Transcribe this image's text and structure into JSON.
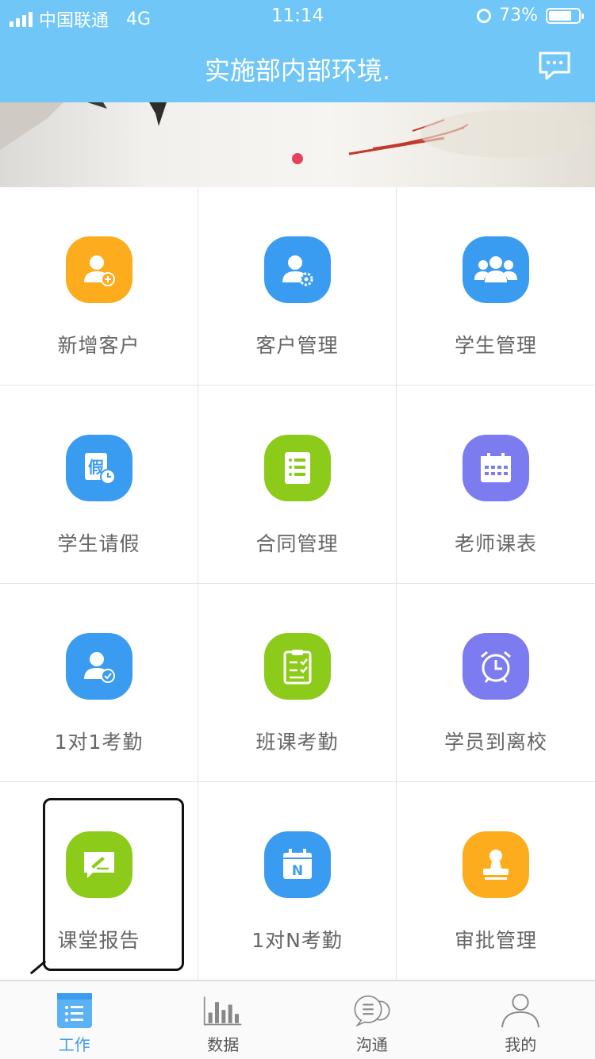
{
  "status_bar": {
    "carrier": "中国联通",
    "network": "4G",
    "time": "11:14",
    "battery": "73%"
  },
  "header": {
    "title": "实施部内部环境."
  },
  "colors": {
    "nav": "#6fc6f7",
    "orange": "#fcac1c",
    "blue": "#3a9cf0",
    "green": "#8dcb1a",
    "purple": "#7d7bf0",
    "indicator": "#e8415e"
  },
  "grid": {
    "items": [
      {
        "label": "新增客户",
        "icon": "user-add-icon"
      },
      {
        "label": "客户管理",
        "icon": "user-settings-icon"
      },
      {
        "label": "学生管理",
        "icon": "users-group-icon"
      },
      {
        "label": "学生请假",
        "icon": "leave-clock-icon"
      },
      {
        "label": "合同管理",
        "icon": "contract-list-icon"
      },
      {
        "label": "老师课表",
        "icon": "calendar-icon"
      },
      {
        "label": "1对1考勤",
        "icon": "user-check-icon"
      },
      {
        "label": "班课考勤",
        "icon": "clipboard-check-icon"
      },
      {
        "label": "学员到离校",
        "icon": "alarm-clock-icon"
      },
      {
        "label": "课堂报告",
        "icon": "report-pen-icon"
      },
      {
        "label": "1对N考勤",
        "icon": "calendar-n-icon"
      },
      {
        "label": "审批管理",
        "icon": "stamp-icon"
      }
    ]
  },
  "tabbar": {
    "tabs": [
      {
        "label": "工作",
        "icon": "work-list-icon"
      },
      {
        "label": "数据",
        "icon": "bar-chart-icon"
      },
      {
        "label": "沟通",
        "icon": "chat-bubbles-icon"
      },
      {
        "label": "我的",
        "icon": "person-icon"
      }
    ]
  }
}
